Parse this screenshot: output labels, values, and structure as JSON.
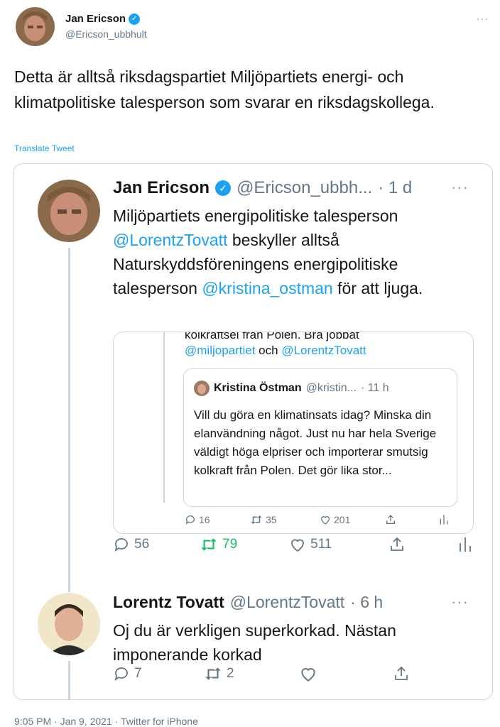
{
  "author": {
    "name": "Jan Ericson",
    "handle": "@Ericson_ubbhult",
    "more": "···"
  },
  "tweet": {
    "text": "Detta är alltså riksdagspartiet Miljöpartiets energi- och klimatpolitiske talesperson som svarar en riksdagskollega.",
    "translate_label": "Translate Tweet",
    "meta": "9:05 PM · Jan 9, 2021 · Twitter for iPhone"
  },
  "quoted": {
    "name": "Jan Ericson",
    "handle": "@Ericson_ubbh...",
    "time": "· 1 d",
    "more": "···",
    "text_1": "Miljöpartiets energipolitiske talesperson ",
    "mention_1": "@LorentzTovatt",
    "text_2": " beskyller alltså Naturskyddsföreningens energipolitiske talesperson ",
    "mention_2": "@kristina_ostman",
    "text_3": " för att ljuga.",
    "nested": {
      "cut_text": "kolkraftsel från Polen. Bra jobbat",
      "mention_a": "@miljopartiet",
      "and_word": " och ",
      "mention_b": "@LorentzTovatt",
      "inner": {
        "name": "Kristina Östman",
        "handle": "@kristin...",
        "time": "· 11 h",
        "text": "Vill du göra en klimatinsats idag? Minska din elanvändning något. Just nu har hela Sverige väldigt höga elpriser och importerar smutsig kolkraft från Polen. Det gör lika stor..."
      },
      "actions": {
        "replies": "16",
        "retweets": "35",
        "likes": "201"
      }
    },
    "actions": {
      "replies": "56",
      "retweets": "79",
      "likes": "511"
    }
  },
  "reply": {
    "name": "Lorentz Tovatt",
    "handle": "@LorentzTovatt",
    "time": "· 6 h",
    "more": "···",
    "text": "Oj du är verkligen superkorkad. Nästan imponerande korkad",
    "actions": {
      "replies": "7",
      "retweets": "2"
    }
  },
  "colors": {
    "link": "#1da1f2",
    "retweet_active": "#17bf63",
    "muted": "#657786",
    "border": "#ccd6dd"
  }
}
